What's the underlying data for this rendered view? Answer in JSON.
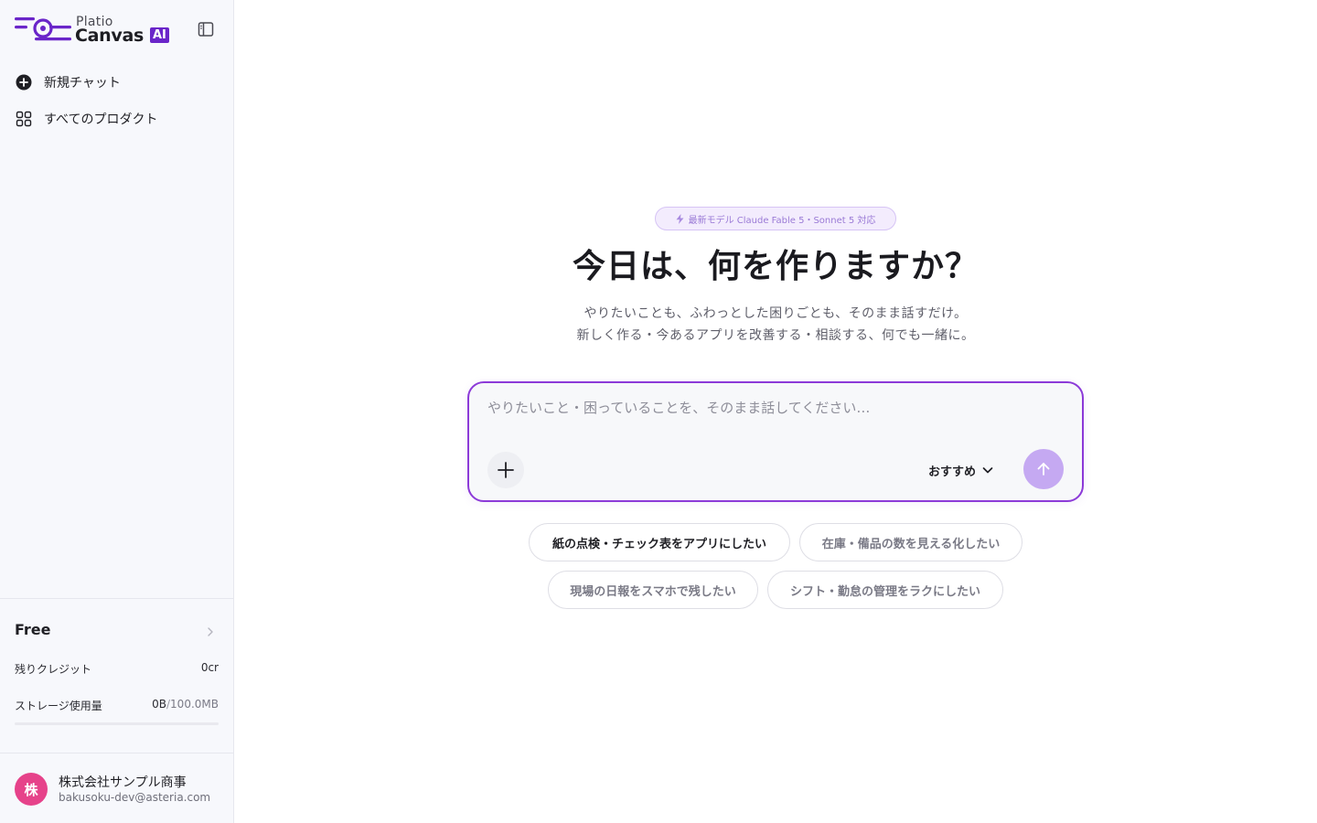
{
  "brand": {
    "platio": "Platio",
    "canvas": "Canvas",
    "ai": "AI",
    "accent": "#6a25c9"
  },
  "sidebar": {
    "toggle_icon": "sidebar-toggle-icon",
    "items": [
      {
        "label": "新規チャット",
        "icon": "plus-circle-icon"
      },
      {
        "label": "すべてのプロダクト",
        "icon": "grid-icon"
      }
    ],
    "plan": {
      "name": "Free",
      "credit_label": "残りクレジット",
      "credit_value": "0cr",
      "storage_label": "ストレージ使用量",
      "storage_used": "0B",
      "storage_sep": "/",
      "storage_total": "100.0MB",
      "storage_fraction": 0
    },
    "user": {
      "avatar_text": "株",
      "avatar_color": "#e6428a",
      "name": "株式会社サンプル商事",
      "email": "bakusoku-dev@asteria.com"
    }
  },
  "main": {
    "badge": "最新モデル Claude Fable 5・Sonnet 5 対応",
    "headline": "今日は、何を作りますか？",
    "sub1": "やりたいことも、ふわっとした困りごとも、そのまま話すだけ。",
    "sub2": "新しく作る・今あるアプリを改善する・相談する、何でも一緒に。",
    "composer": {
      "placeholder": "やりたいこと・困っていることを、そのまま話してください…",
      "model_label": "おすすめ",
      "border_color": "#8c3ad8",
      "send_color": "#c5a9f2"
    },
    "suggestions": [
      "紙の点検・チェック表をアプリにしたい",
      "在庫・備品の数を見える化したい",
      "現場の日報をスマホで残したい",
      "シフト・勤怠の管理をラクにしたい"
    ]
  }
}
